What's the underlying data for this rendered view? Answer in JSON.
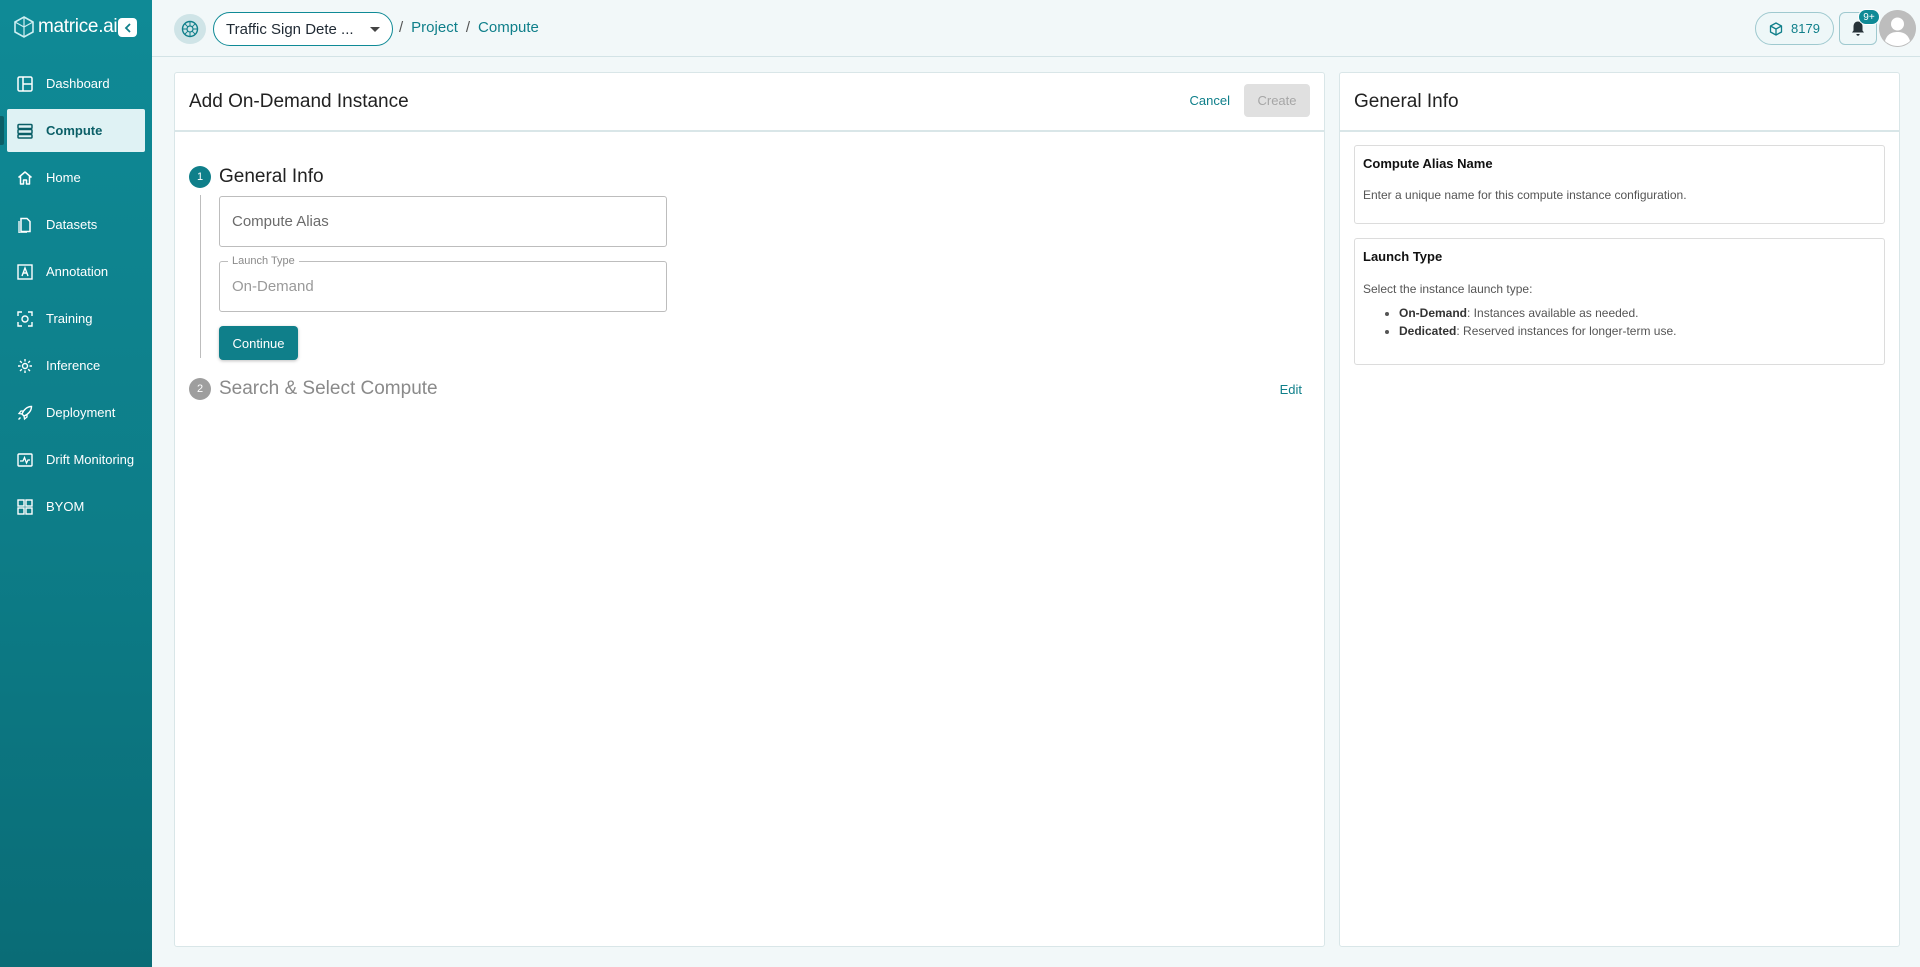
{
  "app": {
    "brand_name": "matrice.ai"
  },
  "sidebar": {
    "items": [
      {
        "label": "Dashboard",
        "icon": "dashboard-icon",
        "active": false
      },
      {
        "label": "Compute",
        "icon": "compute-icon",
        "active": true
      },
      {
        "label": "Home",
        "icon": "home-icon",
        "active": false
      },
      {
        "label": "Datasets",
        "icon": "datasets-icon",
        "active": false
      },
      {
        "label": "Annotation",
        "icon": "annotation-icon",
        "active": false
      },
      {
        "label": "Training",
        "icon": "training-icon",
        "active": false
      },
      {
        "label": "Inference",
        "icon": "inference-icon",
        "active": false
      },
      {
        "label": "Deployment",
        "icon": "deployment-icon",
        "active": false
      },
      {
        "label": "Drift Monitoring",
        "icon": "drift-monitoring-icon",
        "active": false
      },
      {
        "label": "BYOM",
        "icon": "byom-icon",
        "active": false
      }
    ]
  },
  "topbar": {
    "project_select_value": "Traffic Sign Dete ...",
    "breadcrumb": [
      "Project",
      "Compute"
    ],
    "separator": "/",
    "credits": "8179",
    "notifications_badge": "9+"
  },
  "main": {
    "title": "Add On-Demand Instance",
    "cancel_label": "Cancel",
    "create_label": "Create",
    "steps": [
      {
        "num": "1",
        "label": "General Info"
      },
      {
        "num": "2",
        "label": "Search & Select Compute"
      }
    ],
    "alias_placeholder": "Compute Alias",
    "launch_type_legend": "Launch Type",
    "launch_type_value": "On-Demand",
    "continue_label": "Continue",
    "edit_label": "Edit"
  },
  "info": {
    "title": "General Info",
    "alias_card_title": "Compute Alias Name",
    "alias_card_desc": "Enter a unique name for this compute instance configuration.",
    "launch_card_title": "Launch Type",
    "launch_card_desc": "Select the instance launch type:",
    "launch_options": [
      {
        "name": "On-Demand",
        "desc": ": Instances available as needed."
      },
      {
        "name": "Dedicated",
        "desc": ": Reserved instances for longer-term use."
      }
    ]
  },
  "colors": {
    "accent": "#0f8a96",
    "accent_dark": "#0f7f8a",
    "active_nav_bg": "#dff2f4"
  }
}
